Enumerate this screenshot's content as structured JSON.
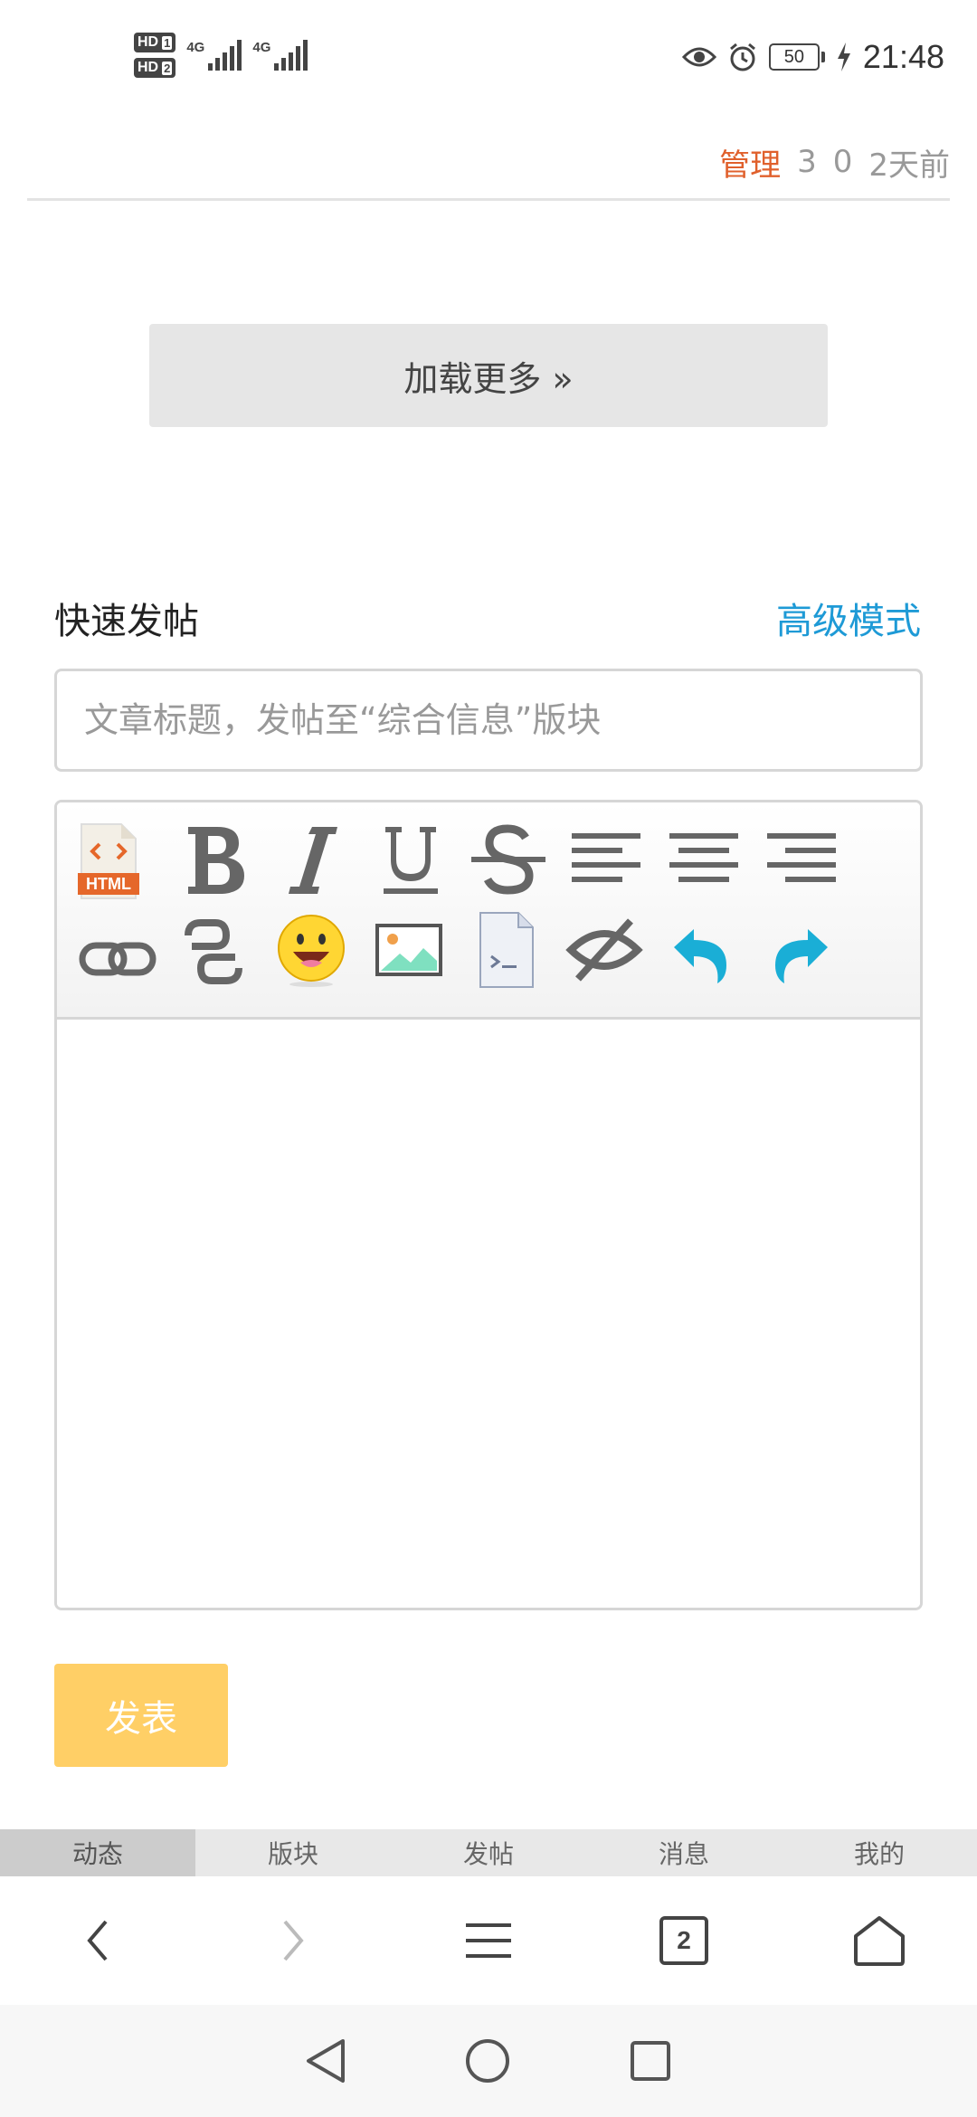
{
  "status_bar": {
    "hd1": "HD",
    "sim1": "1",
    "hd2": "HD",
    "sim2": "2",
    "net1": "4G",
    "net2": "4G",
    "battery": "50",
    "time": "21:48"
  },
  "thread_meta": {
    "manage": "管理",
    "count1": "3",
    "count2": "0",
    "time_ago": "2天前"
  },
  "load_more": "加载更多 »",
  "quick_post": {
    "title": "快速发帖",
    "advanced": "高级模式",
    "title_placeholder": "文章标题，发帖至“综合信息”版块",
    "html_label": "HTML",
    "submit": "发表"
  },
  "tabs": [
    {
      "label": "动态",
      "active": true
    },
    {
      "label": "版块",
      "active": false
    },
    {
      "label": "发帖",
      "active": false
    },
    {
      "label": "消息",
      "active": false
    },
    {
      "label": "我的",
      "active": false
    }
  ],
  "browser_nav": {
    "tab_count": "2"
  },
  "colors": {
    "manage": "#e0602c",
    "advanced": "#1e9ad6",
    "submit": "#ffcf66",
    "undo_redo": "#1aaed6"
  }
}
